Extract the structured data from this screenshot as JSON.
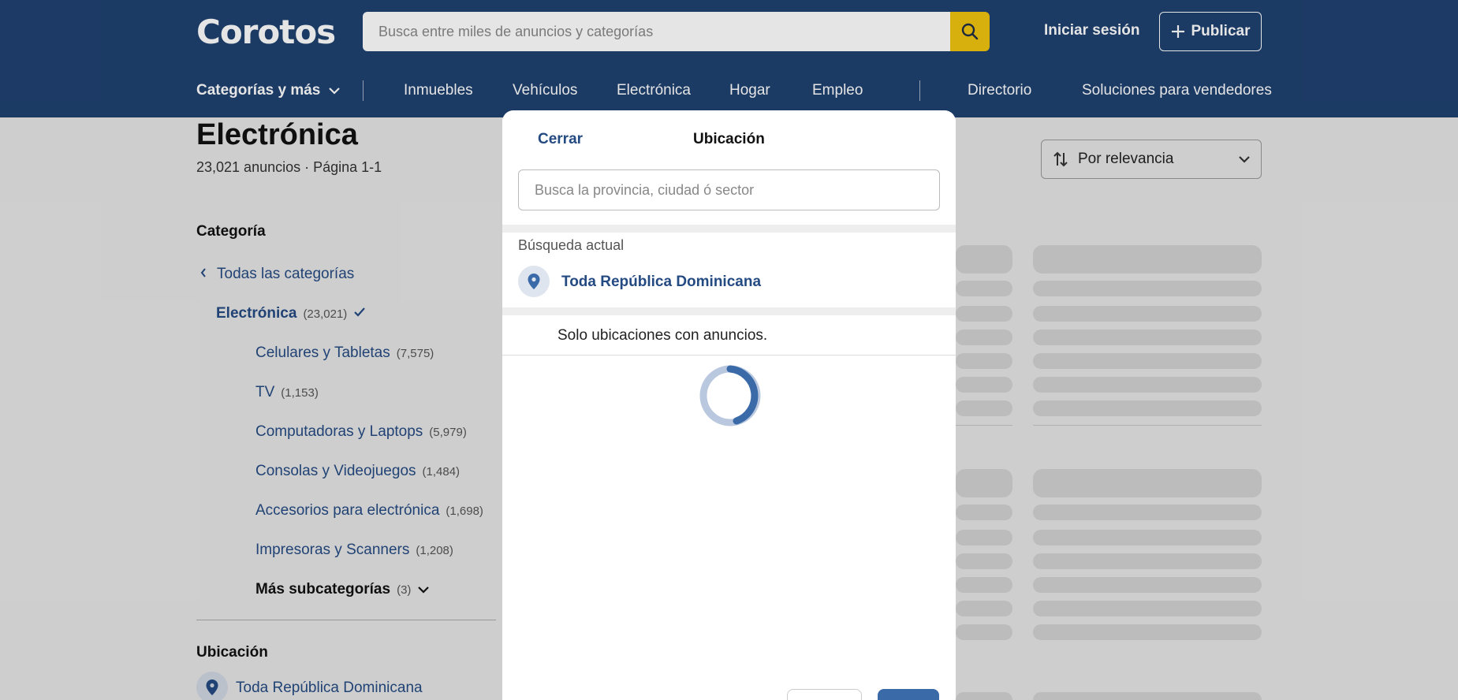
{
  "header": {
    "logo": "Corotos",
    "search_placeholder": "Busca entre miles de anuncios y categorías",
    "login": "Iniciar sesión",
    "publish": "Publicar",
    "nav": {
      "categories": "Categorías y más",
      "items": [
        "Inmuebles",
        "Vehículos",
        "Electrónica",
        "Hogar",
        "Empleo"
      ],
      "right_items": [
        "Directorio",
        "Soluciones para vendedores"
      ]
    }
  },
  "page": {
    "title": "Electrónica",
    "subtitle": "23,021 anuncios · Página 1-1",
    "sort_label": "Por relevancia"
  },
  "sidebar": {
    "category_heading": "Categoría",
    "all_categories": "Todas las categorías",
    "current": {
      "label": "Electrónica",
      "count": "(23,021)"
    },
    "subcategories": [
      {
        "label": "Celulares y Tabletas",
        "count": "(7,575)"
      },
      {
        "label": "TV",
        "count": "(1,153)"
      },
      {
        "label": "Computadoras y Laptops",
        "count": "(5,979)"
      },
      {
        "label": "Consolas y Videojuegos",
        "count": "(1,484)"
      },
      {
        "label": "Accesorios para electrónica",
        "count": "(1,698)"
      },
      {
        "label": "Impresoras y Scanners",
        "count": "(1,208)"
      }
    ],
    "more": {
      "label": "Más subcategorías",
      "count": "(3)"
    },
    "location_heading": "Ubicación",
    "location_value": "Toda República Dominicana"
  },
  "modal": {
    "close": "Cerrar",
    "title": "Ubicación",
    "search_placeholder": "Busca la provincia, ciudad ó sector",
    "current_label": "Búsqueda actual",
    "current_value": "Toda República Dominicana",
    "note": "Solo ubicaciones con anuncios."
  },
  "colors": {
    "header_bg": "#1f4170",
    "accent_yellow": "#f1c40f",
    "link_blue": "#244a82"
  }
}
